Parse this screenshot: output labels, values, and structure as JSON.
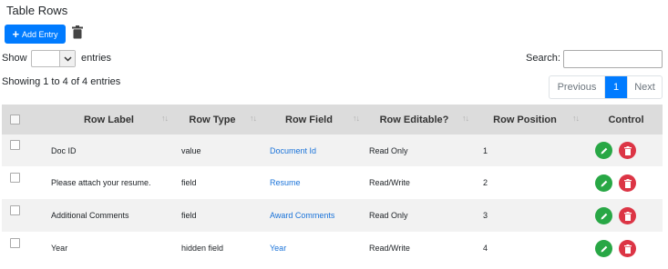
{
  "title": "Table Rows",
  "toolbar": {
    "add_label": "Add Entry"
  },
  "length": {
    "show_label": "Show",
    "entries_label": "entries",
    "selected": ""
  },
  "search": {
    "label": "Search:",
    "value": ""
  },
  "info": "Showing 1 to 4 of 4 entries",
  "pager": {
    "previous": "Previous",
    "page": "1",
    "next": "Next"
  },
  "columns": [
    "Row Label",
    "Row Type",
    "Row Field",
    "Row Editable?",
    "Row Position",
    "Control"
  ],
  "rows": [
    {
      "label": "Doc ID",
      "type": "value",
      "field": "Document Id",
      "editable": "Read Only",
      "position": "1"
    },
    {
      "label": "Please attach your resume.",
      "type": "field",
      "field": "Resume",
      "editable": "Read/Write",
      "position": "2"
    },
    {
      "label": "Additional Comments",
      "type": "field",
      "field": "Award Comments",
      "editable": "Read Only",
      "position": "3"
    },
    {
      "label": "Year",
      "type": "hidden field",
      "field": "Year",
      "editable": "Read/Write",
      "position": "4"
    }
  ],
  "colors": {
    "primary": "#007bff",
    "edit": "#28a745",
    "delete": "#dc3545",
    "link": "#1a73d9",
    "header_bg": "#dcdcdc",
    "stripe": "#f2f2f2"
  }
}
